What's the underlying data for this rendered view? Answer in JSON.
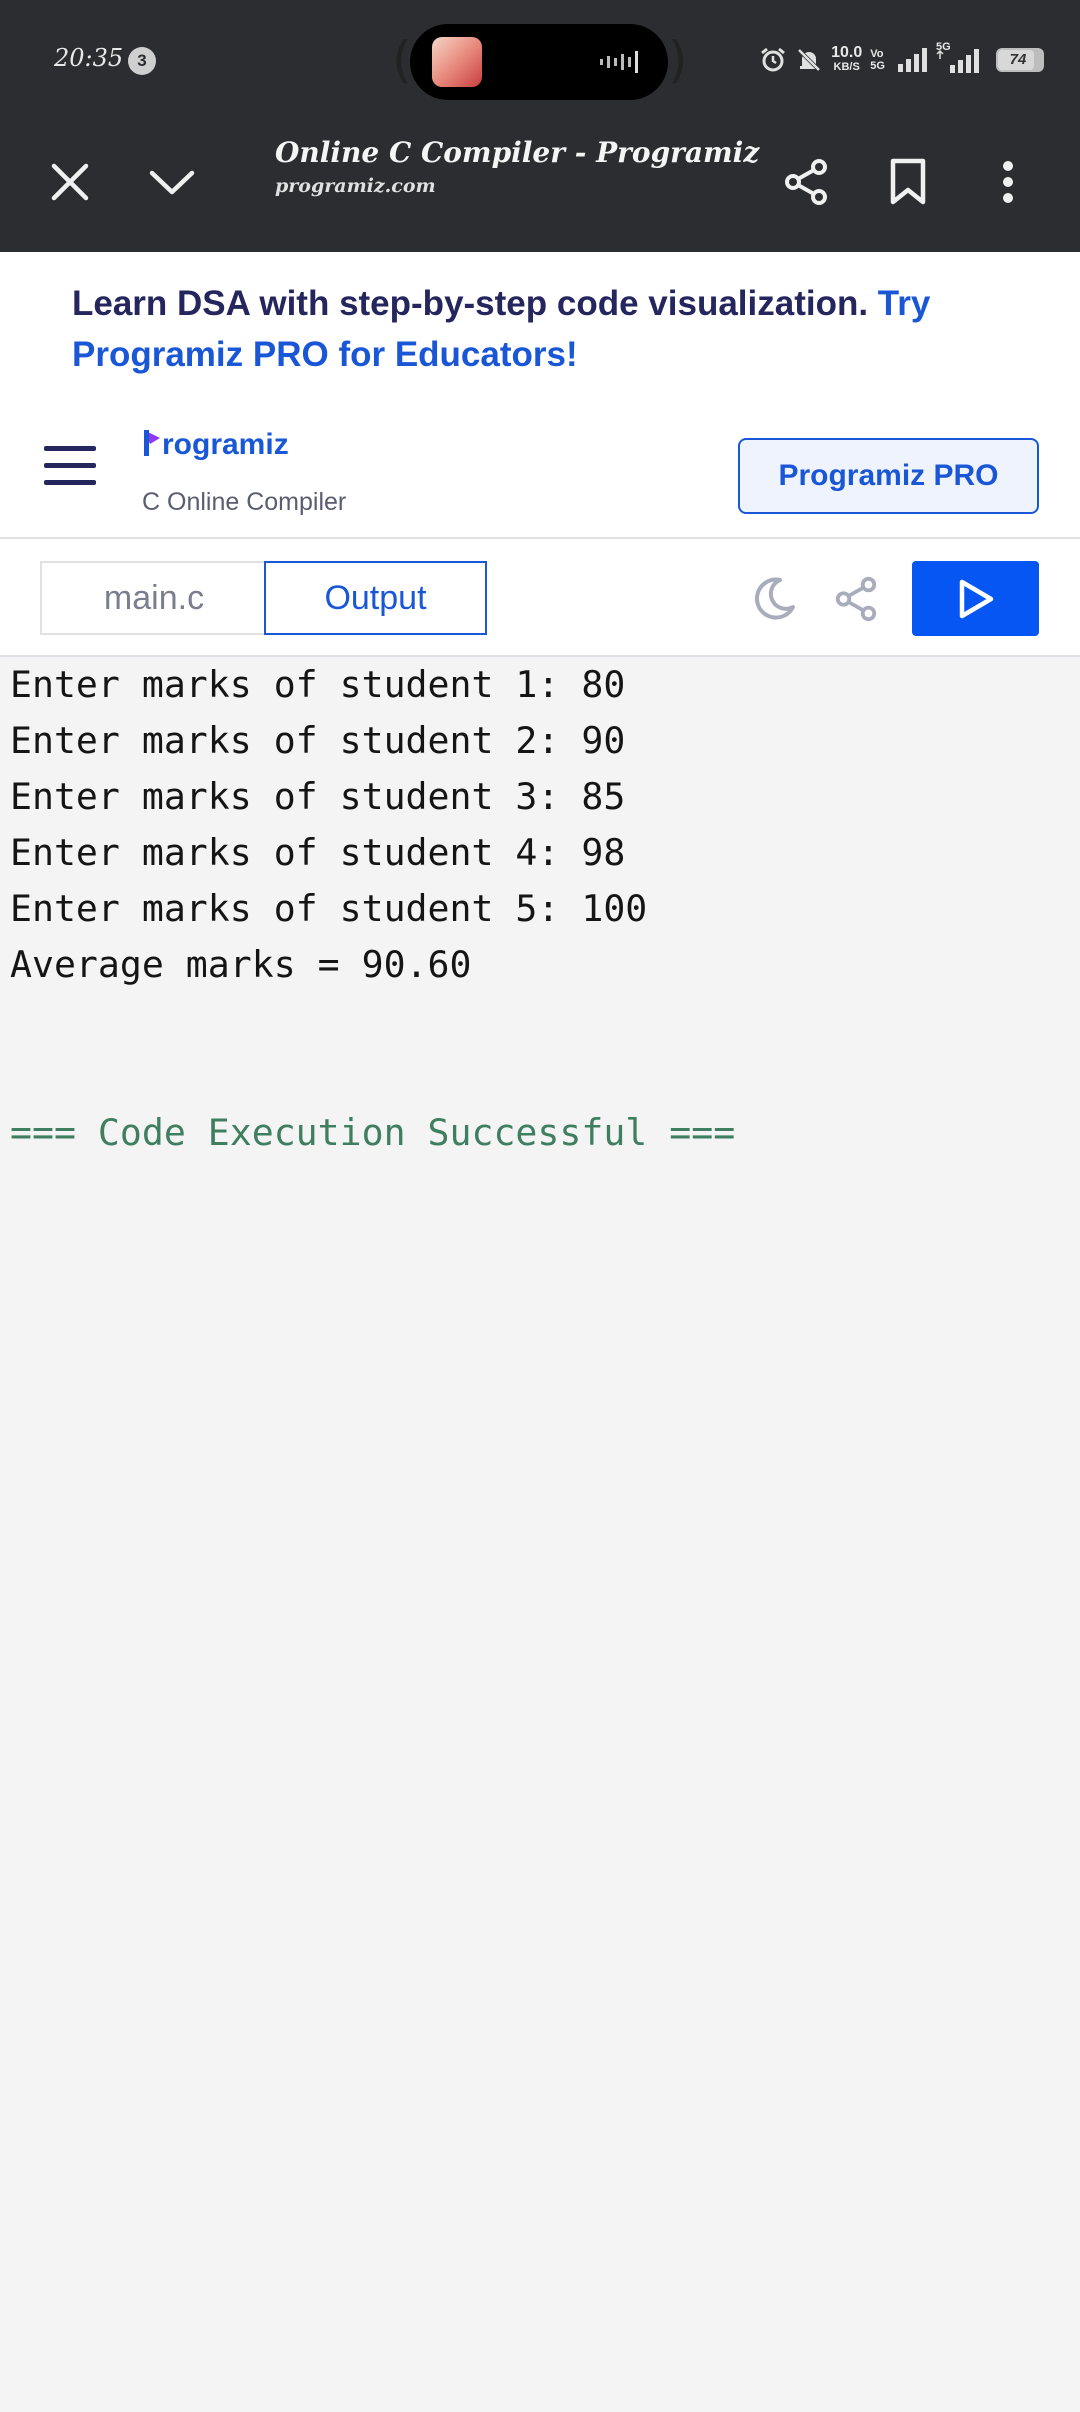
{
  "status_bar": {
    "time": "20:35",
    "notification_count": "3",
    "net_speed": "10.0",
    "net_speed_unit": "KB/S",
    "volte_top": "Vo",
    "volte_bottom": "5G ⁠",
    "network_5g": "5G",
    "battery_level": "74"
  },
  "browser": {
    "page_title": "Online C Compiler - Programiz",
    "url": "programiz.com"
  },
  "banner": {
    "text": "Learn DSA with step-by-step code visualization. ",
    "link_text": "Try Programiz PRO for Educators!"
  },
  "site_header": {
    "logo_text": "rogramiz",
    "subtitle": "C Online Compiler",
    "pro_button": "Programiz PRO"
  },
  "editor": {
    "tab_file": "main.c",
    "tab_output": "Output"
  },
  "output": {
    "lines": [
      "Enter marks of student 1: 80",
      "Enter marks of student 2: 90",
      "Enter marks of student 3: 85",
      "Enter marks of student 4: 98",
      "Enter marks of student 5: 100",
      "Average marks = 90.60"
    ],
    "status": "=== Code Execution Successful ==="
  },
  "colors": {
    "brand_blue": "#1a57d6",
    "run_button": "#0556f3",
    "success_text": "#3f7e60",
    "browser_chrome": "#2c2d30"
  },
  "icons": [
    "close-icon",
    "chevron-down-icon",
    "share-icon",
    "bookmark-icon",
    "more-vert-icon",
    "hamburger-menu-icon",
    "moon-icon",
    "share-icon",
    "play-icon",
    "alarm-icon",
    "bell-off-icon",
    "signal-icon",
    "battery-icon"
  ]
}
